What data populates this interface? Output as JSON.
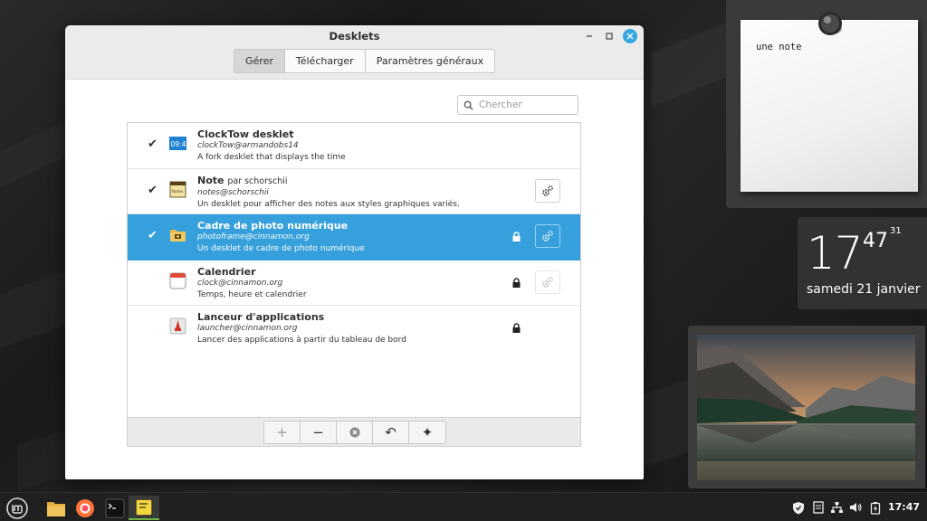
{
  "window": {
    "title": "Desklets",
    "tabs": [
      {
        "label": "Gérer",
        "active": true
      },
      {
        "label": "Télécharger",
        "active": false
      },
      {
        "label": "Paramètres généraux",
        "active": false
      }
    ],
    "search": {
      "placeholder": "Chercher"
    }
  },
  "desklets": [
    {
      "name": "ClockTow desklet",
      "author": "",
      "uuid": "clockTow@armandobs14",
      "description": "A fork desklet that displays the time",
      "enabled": true,
      "locked": false,
      "configurable": false,
      "icon": "clocktow-icon",
      "icon_text": "09:47"
    },
    {
      "name": "Note",
      "author": "par schorschii",
      "uuid": "notes@schorschii",
      "description": "Un desklet pour afficher des notes aux styles graphiques variés.",
      "enabled": true,
      "locked": false,
      "configurable": true,
      "icon": "note-icon",
      "icon_text": "Notes"
    },
    {
      "name": "Cadre de photo numérique",
      "author": "",
      "uuid": "photoframe@cinnamon.org",
      "description": "Un desklet de cadre de photo numérique",
      "enabled": true,
      "locked": true,
      "configurable": true,
      "selected": true,
      "icon": "photo-folder-icon"
    },
    {
      "name": "Calendrier",
      "author": "",
      "uuid": "clock@cinnamon.org",
      "description": "Temps, heure et calendrier",
      "enabled": false,
      "locked": true,
      "configurable": true,
      "config_disabled": true,
      "icon": "calendar-icon"
    },
    {
      "name": "Lanceur d'applications",
      "author": "",
      "uuid": "launcher@cinnamon.org",
      "description": "Lancer des applications à partir du tableau de bord",
      "enabled": false,
      "locked": true,
      "configurable": false,
      "icon": "launcher-icon"
    }
  ],
  "toolbar": {
    "buttons": [
      "add-icon",
      "remove-icon",
      "clear-icon",
      "restore-icon",
      "more-icon"
    ],
    "labels": {
      "add": "+",
      "remove": "−",
      "undo": "↶",
      "extra": "✦"
    }
  },
  "note_desklet": {
    "text": "une note"
  },
  "clock_desklet": {
    "hour": "17",
    "minute": "47",
    "second": "31",
    "date": "samedi 21 janvier"
  },
  "panel": {
    "launchers": [
      "mint-menu-icon",
      "files-icon",
      "firefox-icon",
      "terminal-icon",
      "notes-app-icon"
    ],
    "tray": [
      "shield-icon",
      "notes-tray-icon",
      "network-icon",
      "volume-icon",
      "battery-icon"
    ],
    "time": "17:47"
  },
  "colors": {
    "accent": "#35a0dc",
    "close": "#35a8e0",
    "panel": "#202020",
    "mint_green": "#6db442"
  }
}
